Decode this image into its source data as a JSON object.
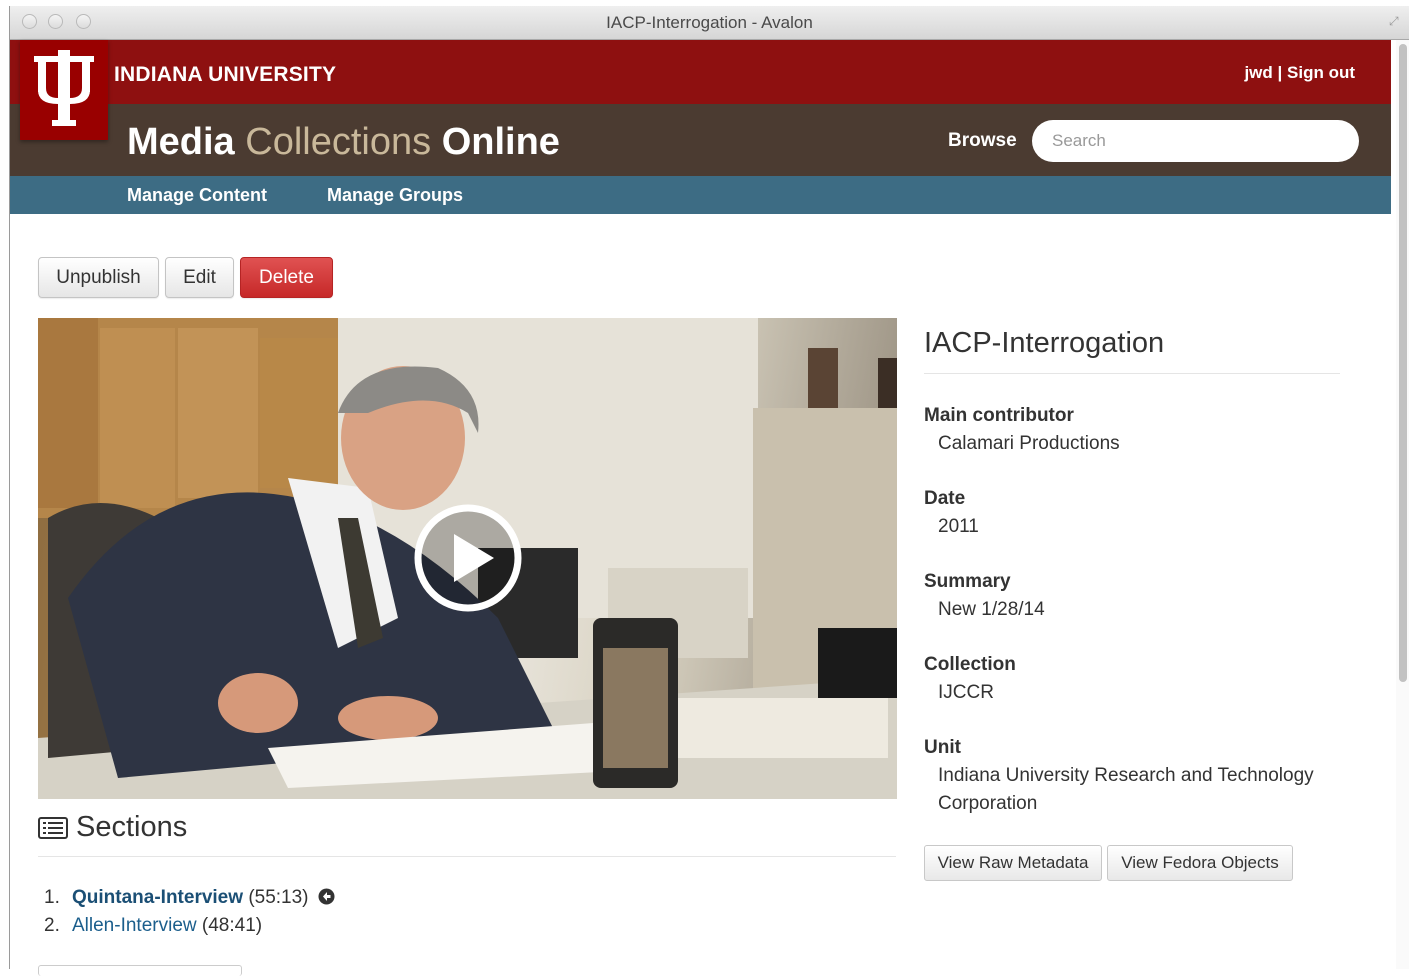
{
  "window": {
    "title": "IACP-Interrogation - Avalon"
  },
  "header": {
    "university": "INDIANA UNIVERSITY",
    "user": "jwd",
    "separator": "|",
    "sign_out": "Sign out",
    "site_title": {
      "part1": "Media",
      "part2": "Collections",
      "part3": "Online"
    },
    "browse": "Browse",
    "search_placeholder": "Search"
  },
  "nav": {
    "manage_content": "Manage Content",
    "manage_groups": "Manage Groups"
  },
  "actions": {
    "unpublish": "Unpublish",
    "edit": "Edit",
    "delete": "Delete"
  },
  "item": {
    "title": "IACP-Interrogation",
    "fields": [
      {
        "label": "Main contributor",
        "value": "Calamari Productions"
      },
      {
        "label": "Date",
        "value": "2011"
      },
      {
        "label": "Summary",
        "value": "New 1/28/14"
      },
      {
        "label": "Collection",
        "value": "IJCCR"
      },
      {
        "label": "Unit",
        "value": "Indiana University Research and Technology Corporation"
      }
    ],
    "view_raw_metadata": "View Raw Metadata",
    "view_fedora_objects": "View Fedora Objects"
  },
  "sections": {
    "heading": "Sections",
    "items": [
      {
        "num": "1.",
        "title": "Quintana-Interview",
        "duration": "(55:13)",
        "current": true
      },
      {
        "num": "2.",
        "title": "Allen-Interview",
        "duration": "(48:41)",
        "current": false
      }
    ]
  },
  "colors": {
    "iu_crimson": "#8e1010",
    "brown_bar": "#4b3b31",
    "nav_blue": "#3d6c84",
    "delete_red": "#d13c3c",
    "link_blue": "#1b5e8c"
  },
  "icons": [
    "iu-trident-logo",
    "play-icon",
    "sections-list-icon",
    "current-section-arrow-icon",
    "window-resize-icon"
  ]
}
